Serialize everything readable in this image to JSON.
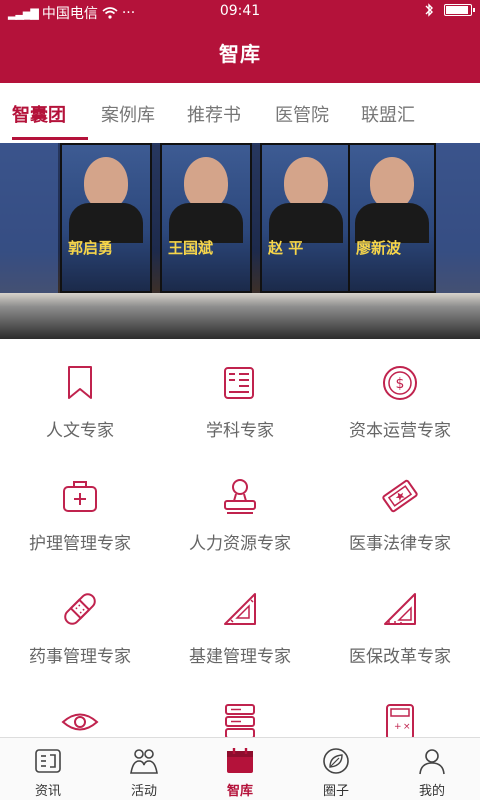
{
  "status_bar": {
    "carrier": "中国电信",
    "time": "09:41",
    "more": "···"
  },
  "header": {
    "title": "智库"
  },
  "tabs": [
    {
      "label": "智囊团",
      "active": true
    },
    {
      "label": "案例库",
      "active": false
    },
    {
      "label": "推荐书",
      "active": false
    },
    {
      "label": "医管院",
      "active": false
    },
    {
      "label": "联盟汇",
      "active": false
    }
  ],
  "banner": {
    "speakers": [
      "郭启勇",
      "王国斌",
      "赵 平",
      "廖新波"
    ]
  },
  "experts": [
    {
      "label": "人文专家",
      "icon": "bookmark-icon"
    },
    {
      "label": "学科专家",
      "icon": "book-icon"
    },
    {
      "label": "资本运营专家",
      "icon": "dollar-coin-icon"
    },
    {
      "label": "护理管理专家",
      "icon": "first-aid-kit-icon"
    },
    {
      "label": "人力资源专家",
      "icon": "stamp-icon"
    },
    {
      "label": "医事法律专家",
      "icon": "law-badge-icon"
    },
    {
      "label": "药事管理专家",
      "icon": "bandage-icon"
    },
    {
      "label": "基建管理专家",
      "icon": "set-square-icon"
    },
    {
      "label": "医保改革专家",
      "icon": "ruler-triangle-icon"
    },
    {
      "label": "",
      "icon": "eye-icon"
    },
    {
      "label": "",
      "icon": "server-icon"
    },
    {
      "label": "",
      "icon": "calculator-icon"
    }
  ],
  "bottom_nav": [
    {
      "label": "资讯",
      "icon": "news-icon",
      "active": false
    },
    {
      "label": "活动",
      "icon": "people-icon",
      "active": false
    },
    {
      "label": "智库",
      "icon": "calendar-icon",
      "active": true
    },
    {
      "label": "圈子",
      "icon": "leaf-circle-icon",
      "active": false
    },
    {
      "label": "我的",
      "icon": "user-icon",
      "active": false
    }
  ],
  "colors": {
    "brand": "#b4123a",
    "icon_stroke": "#c0234e",
    "inactive_text": "#666666"
  }
}
